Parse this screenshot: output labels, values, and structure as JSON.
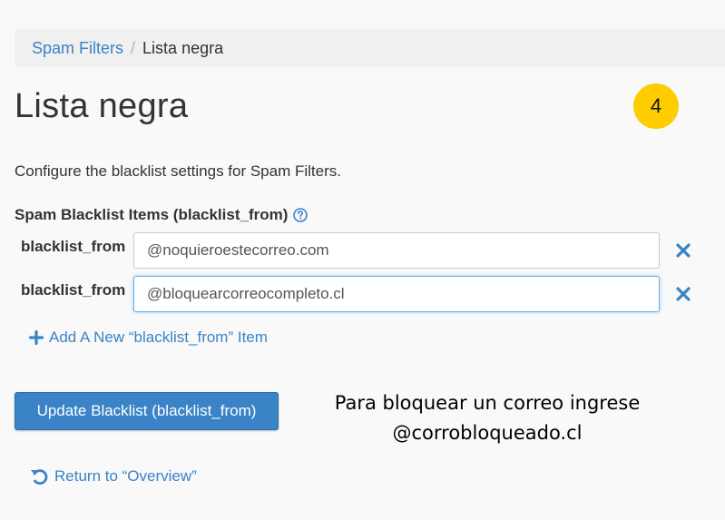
{
  "breadcrumb": {
    "parent": "Spam Filters",
    "separator": "/",
    "current": "Lista negra"
  },
  "page_title": "Lista negra",
  "step_badge": "4",
  "description": "Configure the blacklist settings for Spam Filters.",
  "section_label": "Spam Blacklist Items (blacklist_from)",
  "items": [
    {
      "label": "blacklist_from",
      "value": "@noquieroestecorreo.com"
    },
    {
      "label": "blacklist_from",
      "value": "@bloquearcorreocompleto.cl"
    }
  ],
  "add_link": "Add A New “blacklist_from” Item",
  "update_button": "Update Blacklist (blacklist_from)",
  "annotation": {
    "line1": "Para bloquear un correo ingrese",
    "line2": "@corrobloqueado.cl"
  },
  "return_link": "Return to “Overview”",
  "colors": {
    "link": "#3a83c6",
    "badge": "#ffcc00",
    "primary_button": "#3a83c6"
  }
}
